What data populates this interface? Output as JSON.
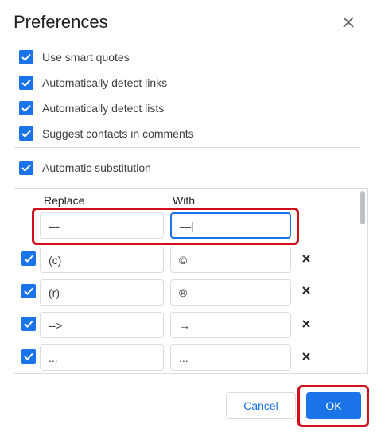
{
  "dialog": {
    "title": "Preferences"
  },
  "options": [
    {
      "label": "Use smart quotes",
      "checked": true
    },
    {
      "label": "Automatically detect links",
      "checked": true
    },
    {
      "label": "Automatically detect lists",
      "checked": true
    },
    {
      "label": "Suggest contacts in comments",
      "checked": true
    }
  ],
  "substitution": {
    "label": "Automatic substitution",
    "checked": true,
    "headers": {
      "replace": "Replace",
      "with": "With"
    },
    "new_row": {
      "replace": "---",
      "with": "—|"
    },
    "rows": [
      {
        "replace": "(c)",
        "with": "©",
        "checked": true
      },
      {
        "replace": "(r)",
        "with": "®",
        "checked": true
      },
      {
        "replace": "-->",
        "with": "→",
        "checked": true
      },
      {
        "replace": "...",
        "with": "...",
        "checked": true
      }
    ]
  },
  "buttons": {
    "cancel": "Cancel",
    "ok": "OK"
  },
  "colors": {
    "accent": "#1a73e8",
    "highlight": "#d0101b"
  }
}
